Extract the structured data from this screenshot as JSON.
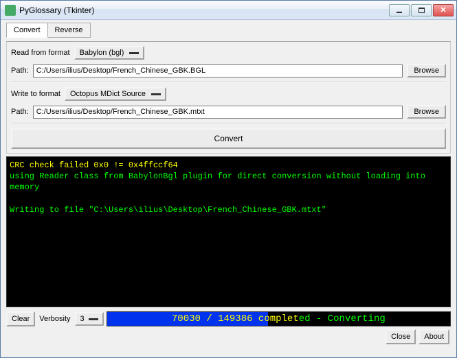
{
  "titlebar": {
    "title": "PyGlossary (Tkinter)"
  },
  "tabs": {
    "convert": "Convert",
    "reverse": "Reverse"
  },
  "read": {
    "format_label": "Read from format",
    "format_value": "Babylon (bgl)",
    "path_label": "Path:",
    "path_value": "C:/Users/ilius/Desktop/French_Chinese_GBK.BGL",
    "browse": "Browse"
  },
  "write": {
    "format_label": "Write to format",
    "format_value": "Octopus MDict Source",
    "path_label": "Path:",
    "path_value": "C:/Users/ilius/Desktop/French_Chinese_GBK.mtxt",
    "browse": "Browse"
  },
  "convert_button": "Convert",
  "terminal": {
    "line1": "CRC check failed 0x0 != 0x4ffccf64",
    "line2": "using Reader class from BabylonBgl plugin for direct conversion without loading into memory",
    "line3": "Writing to file \"C:\\Users\\ilius\\Desktop\\French_Chinese_GBK.mtxt\""
  },
  "bottom": {
    "clear": "Clear",
    "verbosity_label": "Verbosity",
    "verbosity_value": "3",
    "progress_inside": "70030 / 149386 complet",
    "progress_outside": "ed - Converting",
    "progress_percent": 47
  },
  "footer": {
    "close": "Close",
    "about": "About"
  }
}
